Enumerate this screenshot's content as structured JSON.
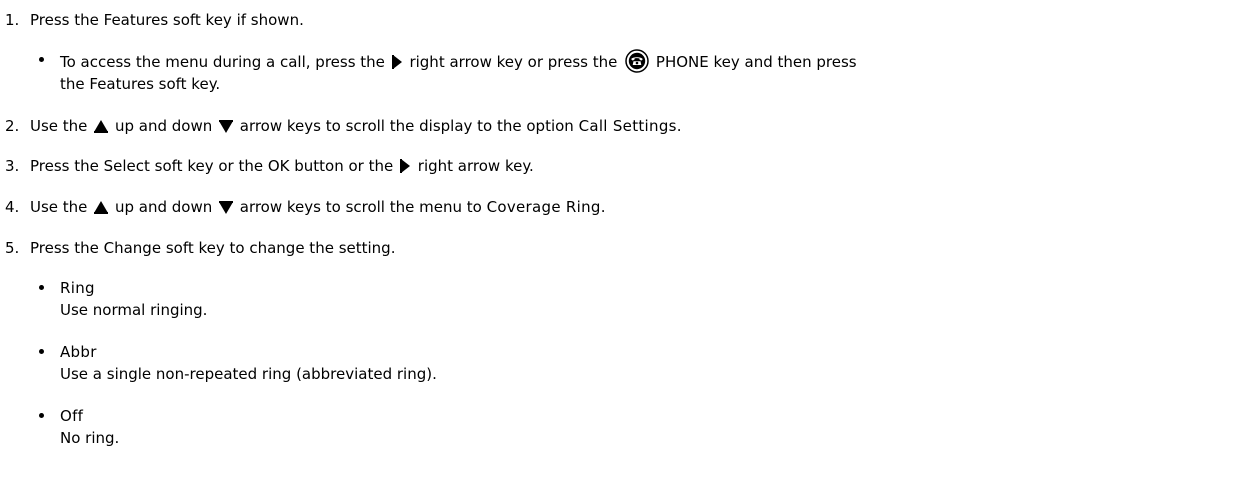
{
  "steps": [
    {
      "num": "1.",
      "text": "Press the Features soft key if shown."
    },
    {
      "num": "2.",
      "pre": "Use the ",
      "mid": " up and down ",
      "post": " arrow keys to scroll the display to the option ",
      "term": "Call Settings",
      "end": "."
    },
    {
      "num": "3.",
      "pre": "Press the Select soft key or the OK button or the ",
      "post": " right arrow key."
    },
    {
      "num": "4.",
      "pre": "Use the ",
      "mid": " up and down ",
      "post": " arrow keys to scroll the menu to ",
      "term": "Coverage Ring",
      "end": "."
    },
    {
      "num": "5.",
      "text": "Press the Change soft key to change the setting."
    }
  ],
  "sub_bullet_1": {
    "pre": "To access the menu during a call, press the ",
    "mid": " right arrow key or press the ",
    "post": " PHONE key and then press",
    "line2": "the Features soft key."
  },
  "options": [
    {
      "term": "Ring",
      "desc": "Use normal ringing."
    },
    {
      "term": "Abbr",
      "desc": "Use a single non-repeated ring (abbreviated ring)."
    },
    {
      "term": "Off",
      "desc": "No ring."
    }
  ],
  "icons": {
    "right": "right-arrow-icon",
    "up": "up-arrow-icon",
    "down": "down-arrow-icon",
    "phone": "phone-key-icon"
  }
}
